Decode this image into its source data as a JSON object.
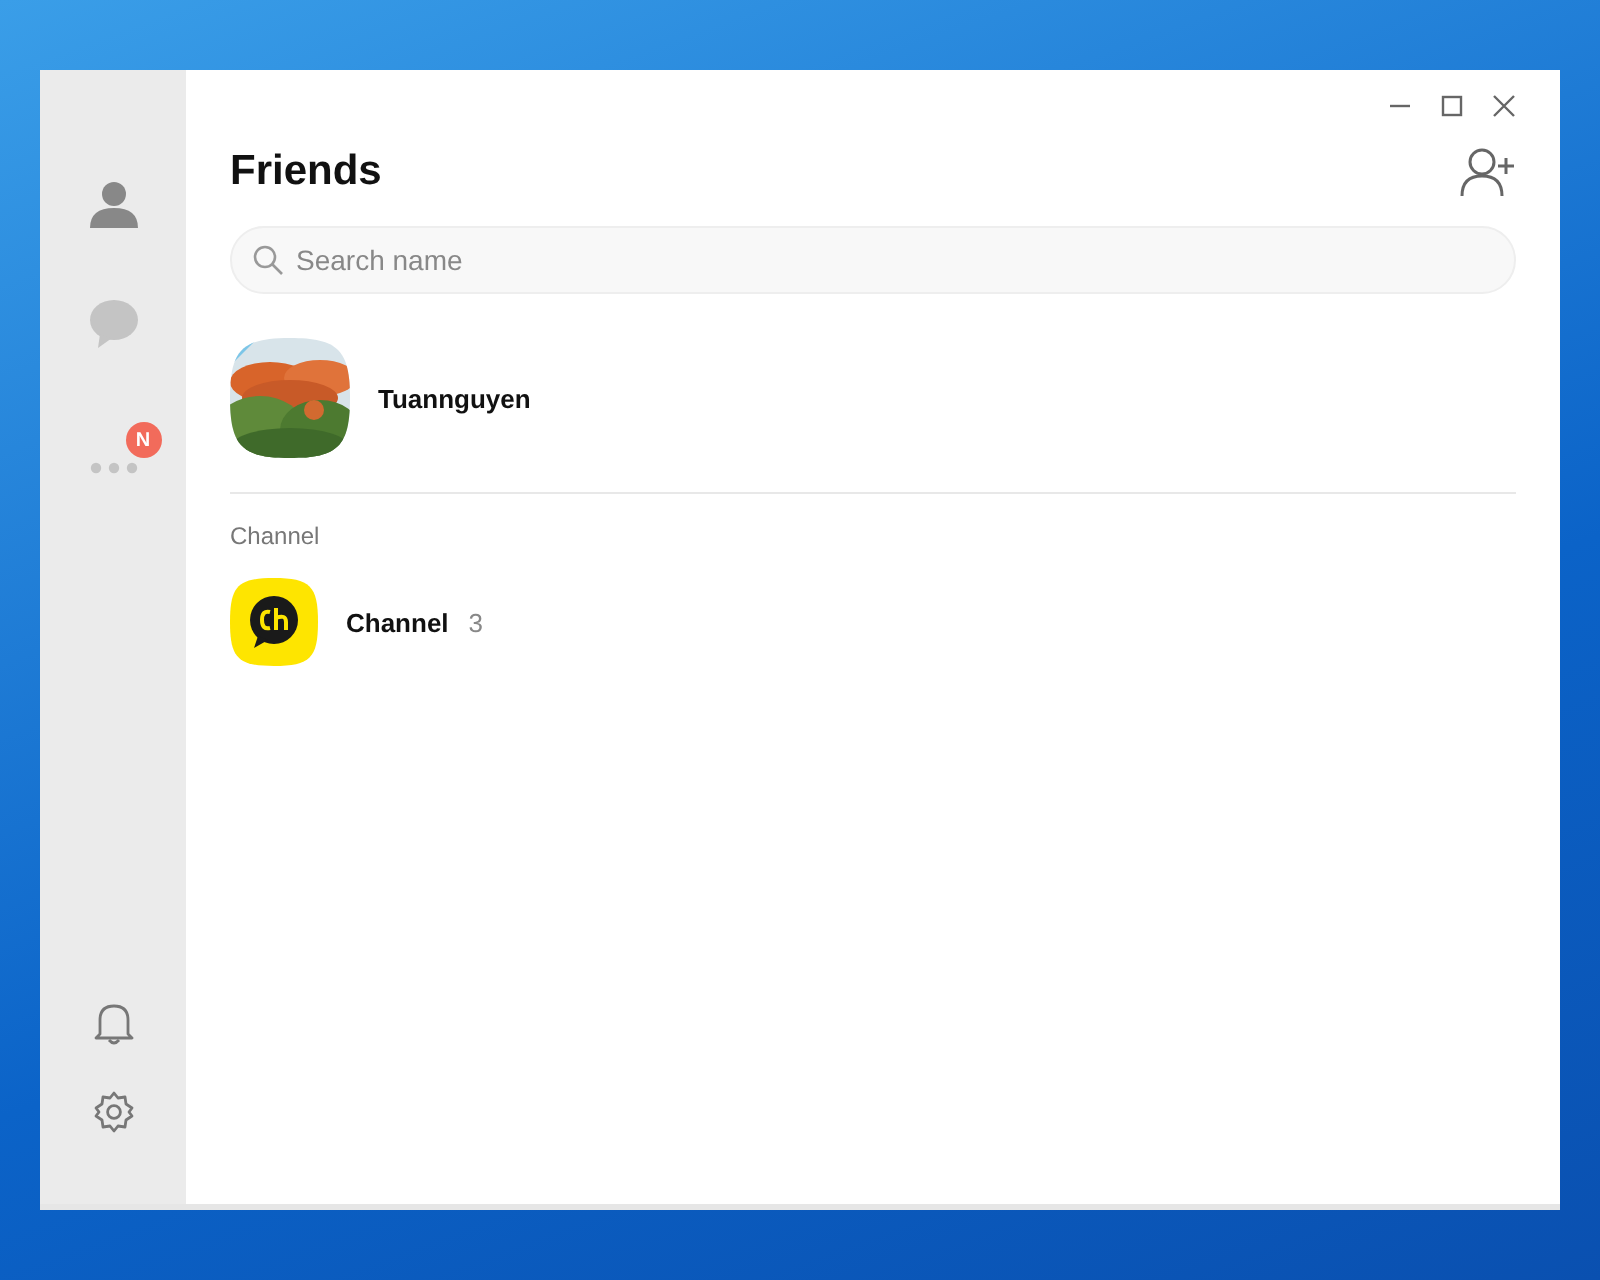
{
  "sidebar": {
    "nav": [
      {
        "kind": "friends",
        "selected": true
      },
      {
        "kind": "chats",
        "selected": false
      },
      {
        "kind": "more",
        "selected": false,
        "badge": "N"
      }
    ],
    "bottom": [
      {
        "kind": "bell"
      },
      {
        "kind": "gear"
      }
    ]
  },
  "header": {
    "title": "Friends"
  },
  "search": {
    "placeholder": "Search name"
  },
  "profile": {
    "name": "Tuannguyen"
  },
  "section": {
    "label": "Channel"
  },
  "channels": [
    {
      "name": "Channel",
      "count": "3"
    }
  ]
}
